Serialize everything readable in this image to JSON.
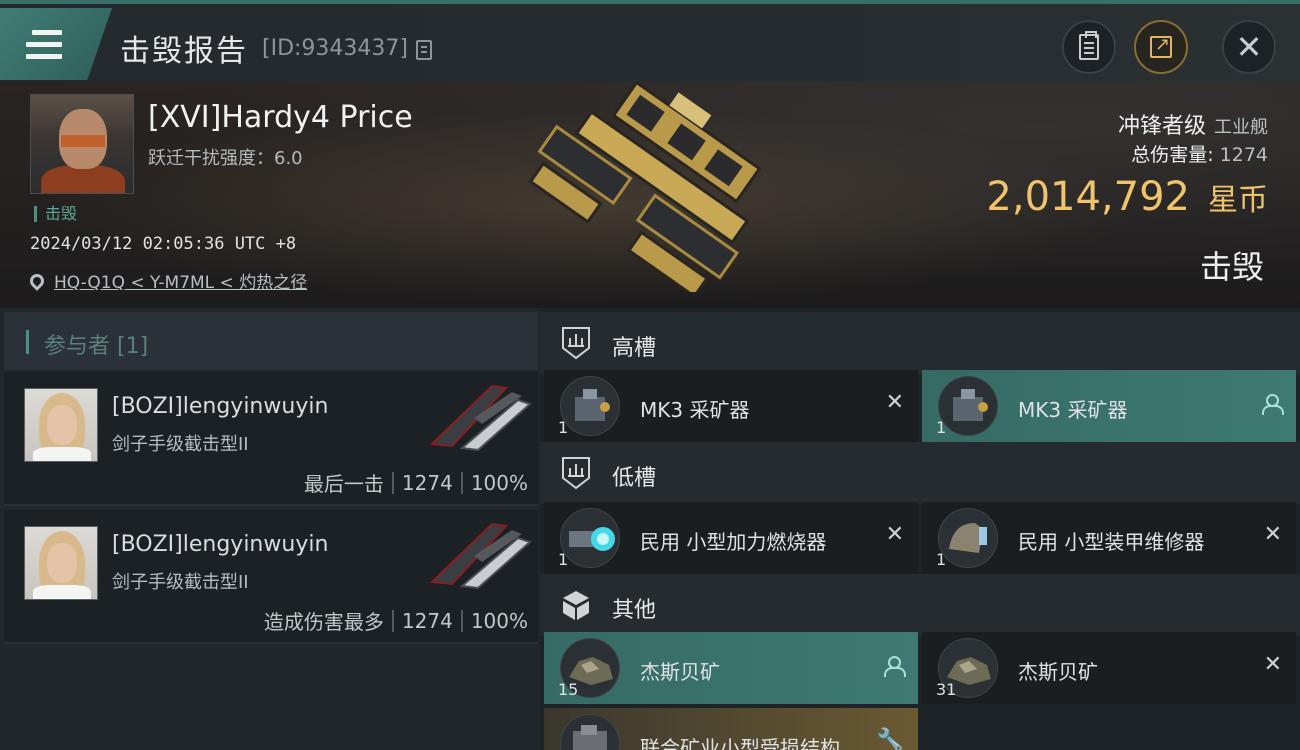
{
  "header": {
    "title": "击毁报告",
    "report_id": "[ID:9343437]"
  },
  "victim": {
    "name": "[XVI]Hardy4 Price",
    "warp_disruption": "跃迁干扰强度：6.0",
    "status": "击毁",
    "timestamp": "2024/03/12 02:05:36 UTC +8",
    "location": "HQ-Q1Q < Y-M7ML < 灼热之径",
    "ship_class": "冲锋者级",
    "ship_type": "工业舰",
    "damage_label": "总伤害量:",
    "damage_value": "1274",
    "isk_value": "2,014,792",
    "isk_unit": "星币",
    "result": "击毁"
  },
  "participants": {
    "heading": "参与者 [1]",
    "rows": [
      {
        "name": "[BOZI]lengyinwuyin",
        "ship": "剑子手级截击型II",
        "tag": "最后一击",
        "damage": "1274",
        "percent": "100%"
      },
      {
        "name": "[BOZI]lengyinwuyin",
        "ship": "剑子手级截击型II",
        "tag": "造成伤害最多",
        "damage": "1274",
        "percent": "100%"
      }
    ]
  },
  "fitting": {
    "high": {
      "label": "高槽",
      "items": [
        {
          "qty": "1",
          "name": "MK3 采矿器",
          "state": "destroyed",
          "icon": "close-icon"
        },
        {
          "qty": "1",
          "name": "MK3 采矿器",
          "state": "dropped",
          "icon": "person-icon"
        }
      ]
    },
    "low": {
      "label": "低槽",
      "items": [
        {
          "qty": "1",
          "name": "民用 小型加力燃烧器",
          "state": "destroyed",
          "icon": "close-icon"
        },
        {
          "qty": "1",
          "name": "民用 小型装甲维修器",
          "state": "destroyed",
          "icon": "close-icon"
        }
      ]
    },
    "other": {
      "label": "其他",
      "items": [
        {
          "qty": "15",
          "name": "杰斯贝矿",
          "state": "dropped",
          "icon": "person-icon"
        },
        {
          "qty": "31",
          "name": "杰斯贝矿",
          "state": "destroyed",
          "icon": "close-icon"
        },
        {
          "qty": "",
          "name": "联合矿业小型受损结构",
          "state": "partial",
          "icon": "wrench-icon"
        }
      ]
    }
  },
  "colors": {
    "accent_teal": "#3e7a71",
    "isk_gold": "#f1c46c",
    "background": "#1b1f23"
  }
}
